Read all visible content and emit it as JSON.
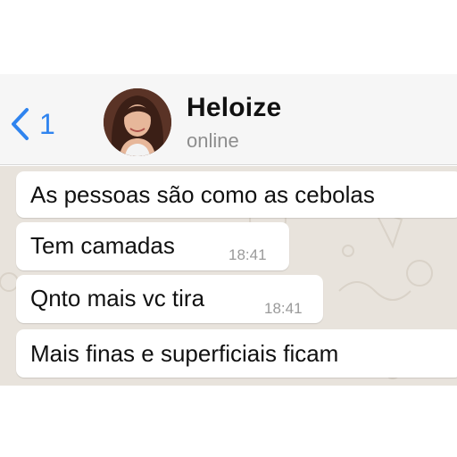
{
  "header": {
    "back_count": "1",
    "contact_name": "Heloize",
    "contact_status": "online"
  },
  "messages": [
    {
      "text": "As pessoas são como as cebolas",
      "time": ""
    },
    {
      "text": "Tem camadas",
      "time": "18:41"
    },
    {
      "text": "Qnto mais vc tira",
      "time": "18:41"
    },
    {
      "text": "Mais finas e superficiais ficam",
      "time": ""
    }
  ],
  "colors": {
    "accent": "#2f84ef",
    "header_bg": "#f6f6f6",
    "chat_bg": "#e8e3dc",
    "bubble_bg": "#ffffff"
  },
  "icons": {
    "back": "chevron-left-icon",
    "avatar": "contact-avatar"
  }
}
